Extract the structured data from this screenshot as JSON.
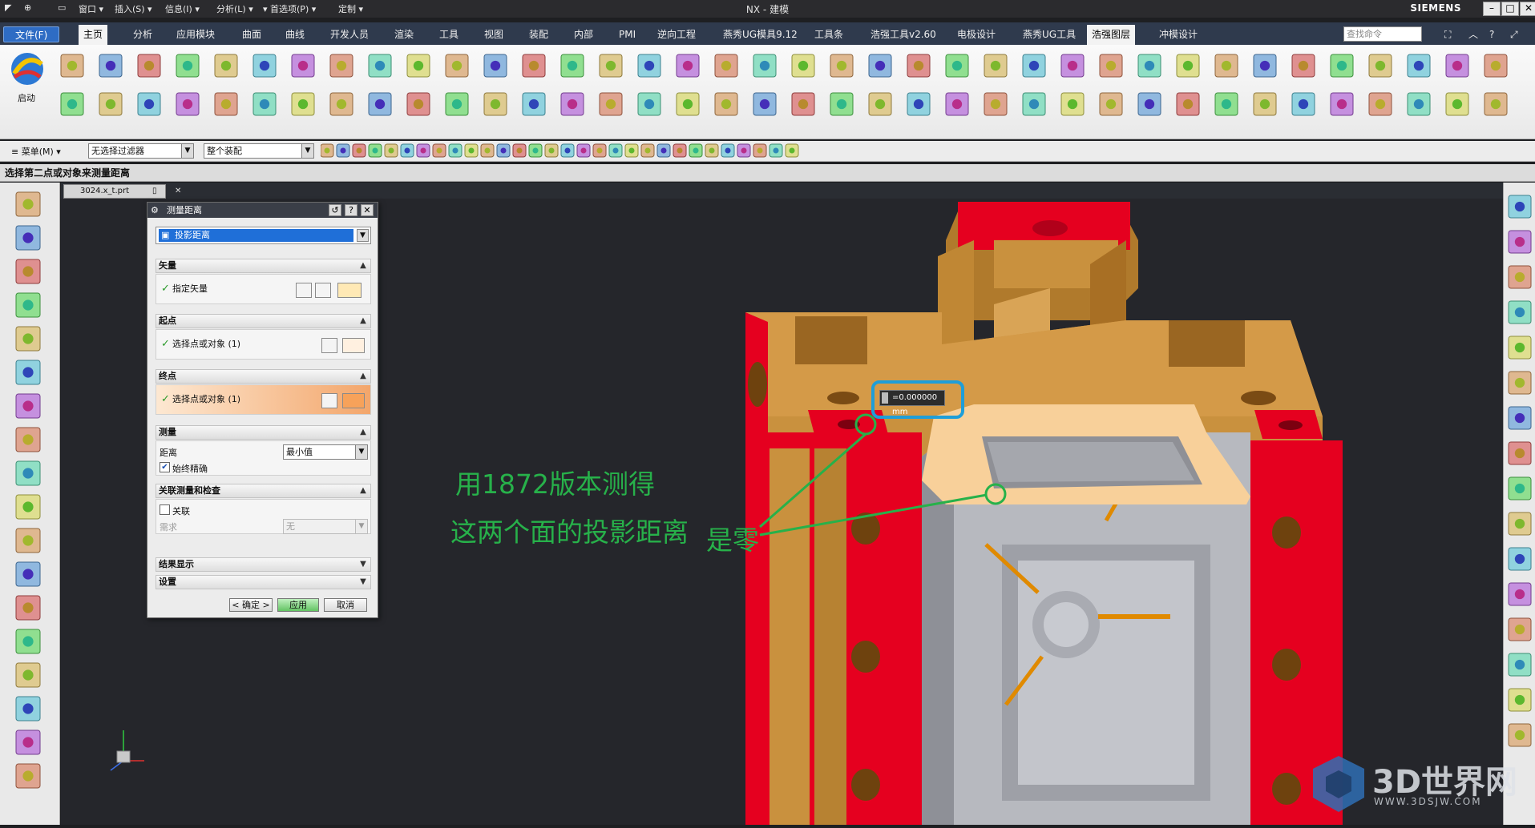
{
  "titlebar": {
    "menus": [
      "窗口 ▾",
      "插入(S) ▾",
      "信息(I) ▾",
      "分析(L) ▾",
      "▾ 首选项(P) ▾",
      "定制 ▾"
    ],
    "title": "NX - 建模",
    "brand": "SIEMENS"
  },
  "tabs": [
    "文件(F)",
    "主页",
    "分析",
    "应用模块",
    "曲面",
    "曲线",
    "开发人员",
    "渲染",
    "工具",
    "视图",
    "装配",
    "内部",
    "PMI",
    "逆向工程",
    "燕秀UG模具9.12",
    "工具条",
    "浩强工具v2.60",
    "电极设计",
    "燕秀UG工具",
    "浩强图层",
    "冲模设计"
  ],
  "search_placeholder": "查找命令",
  "start_label": "启动",
  "selbar": {
    "menu_label": "≡ 菜单(M) ▾",
    "filter_value": "无选择过滤器",
    "assembly_value": "整个装配"
  },
  "status_message": "选择第二点或对象来测量距离",
  "doc_tab": "3024.x_t.prt",
  "dialog": {
    "title": "测量距离",
    "type_value": "投影距离",
    "sections": {
      "vector": "矢量",
      "start": "起点",
      "end": "终点",
      "measure": "测量",
      "related": "关联测量和检查",
      "results": "结果显示",
      "settings": "设置"
    },
    "rows": {
      "vector": "指定矢量",
      "start": "选择点或对象 (1)",
      "end": "选择点或对象 (1)"
    },
    "distance_label": "距离",
    "distance_value": "最小值",
    "accurate_label": "始终精确",
    "related_label": "关联",
    "requirement_label": "需求",
    "requirement_value": "无",
    "ok": "< 确定 >",
    "apply": "应用",
    "cancel": "取消"
  },
  "measure_readout": "=0.000000 mm",
  "annotation": {
    "line1": "用1872版本测得",
    "line2": "这两个面的投影距离",
    "line3": "是零"
  },
  "watermark": {
    "big": "3D世界网",
    "small": "WWW.3DSJW.COM"
  },
  "colors": {
    "accent_green": "#27b14a",
    "highlight_blue": "#1f9ed8",
    "part_red": "#e5001f",
    "part_tan": "#c9913e",
    "part_gray": "#b7b9bf",
    "part_highlight": "#f8d09a"
  }
}
